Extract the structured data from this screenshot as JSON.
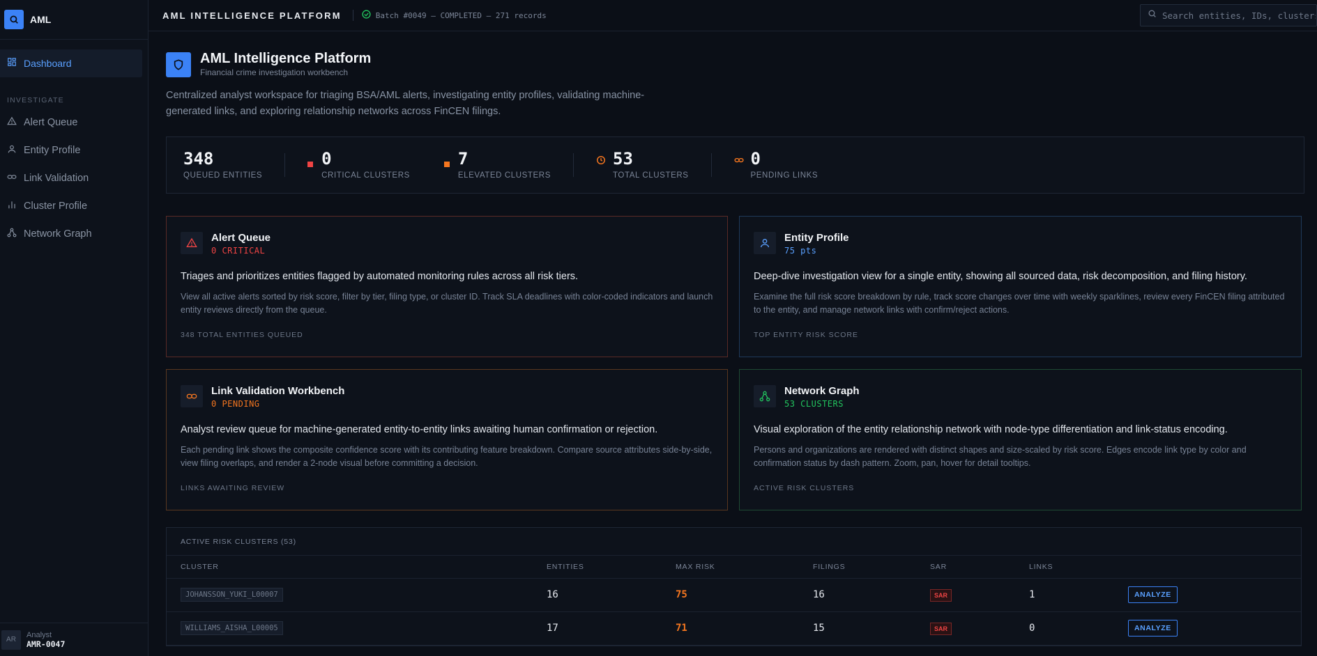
{
  "brand": {
    "name": "AML"
  },
  "sidebar": {
    "active": {
      "label": "Dashboard"
    },
    "section_label": "INVESTIGATE",
    "items": [
      {
        "label": "Alert Queue",
        "icon": "alert-triangle-icon"
      },
      {
        "label": "Entity Profile",
        "icon": "user-icon"
      },
      {
        "label": "Link Validation",
        "icon": "link-icon"
      },
      {
        "label": "Cluster Profile",
        "icon": "bar-chart-icon"
      },
      {
        "label": "Network Graph",
        "icon": "network-icon"
      }
    ],
    "user": {
      "initials": "AR",
      "role": "Analyst",
      "id": "AMR-0047"
    }
  },
  "topbar": {
    "title": "AML INTELLIGENCE PLATFORM",
    "batch": "Batch #0049 — COMPLETED — 271 records",
    "search_placeholder": "Search entities, IDs, clusters..."
  },
  "header": {
    "title": "AML Intelligence Platform",
    "subtitle": "Financial crime investigation workbench",
    "description": "Centralized analyst workspace for triaging BSA/AML alerts, investigating entity profiles, validating machine-generated links, and exploring relationship networks across FinCEN filings."
  },
  "stats": [
    {
      "value": "348",
      "label": "QUEUED ENTITIES"
    },
    {
      "value": "0",
      "label": "CRITICAL CLUSTERS"
    },
    {
      "value": "7",
      "label": "ELEVATED CLUSTERS"
    },
    {
      "value": "53",
      "label": "TOTAL CLUSTERS"
    },
    {
      "value": "0",
      "label": "PENDING LINKS"
    }
  ],
  "cards": {
    "alert": {
      "title": "Alert Queue",
      "meta": "0 CRITICAL",
      "lead": "Triages and prioritizes entities flagged by automated monitoring rules across all risk tiers.",
      "body": "View all active alerts sorted by risk score, filter by tier, filing type, or cluster ID. Track SLA deadlines with color-coded indicators and launch entity reviews directly from the queue.",
      "foot": "348 TOTAL ENTITIES QUEUED"
    },
    "entity": {
      "title": "Entity Profile",
      "meta": "75 pts",
      "lead": "Deep-dive investigation view for a single entity, showing all sourced data, risk decomposition, and filing history.",
      "body": "Examine the full risk score breakdown by rule, track score changes over time with weekly sparklines, review every FinCEN filing attributed to the entity, and manage network links with confirm/reject actions.",
      "foot": "TOP ENTITY RISK SCORE"
    },
    "link": {
      "title": "Link Validation Workbench",
      "meta": "0 PENDING",
      "lead": "Analyst review queue for machine-generated entity-to-entity links awaiting human confirmation or rejection.",
      "body": "Each pending link shows the composite confidence score with its contributing feature breakdown. Compare source attributes side-by-side, view filing overlaps, and render a 2-node visual before committing a decision.",
      "foot": "LINKS AWAITING REVIEW"
    },
    "network": {
      "title": "Network Graph",
      "meta": "53 CLUSTERS",
      "lead": "Visual exploration of the entity relationship network with node-type differentiation and link-status encoding.",
      "body": "Persons and organizations are rendered with distinct shapes and size-scaled by risk score. Edges encode link type by color and confirmation status by dash pattern. Zoom, pan, hover for detail tooltips.",
      "foot": "ACTIVE RISK CLUSTERS"
    }
  },
  "clusters_table": {
    "title": "ACTIVE RISK CLUSTERS (53)",
    "columns": [
      "CLUSTER",
      "ENTITIES",
      "MAX RISK",
      "FILINGS",
      "SAR",
      "LINKS",
      ""
    ],
    "rows": [
      {
        "cluster": "JOHANSSON_YUKI_L00007",
        "entities": "16",
        "max_risk": "75",
        "filings": "16",
        "sar": "SAR",
        "links": "1",
        "action": "ANALYZE"
      },
      {
        "cluster": "WILLIAMS_AISHA_L00005",
        "entities": "17",
        "max_risk": "71",
        "filings": "15",
        "sar": "SAR",
        "links": "0",
        "action": "ANALYZE"
      }
    ]
  },
  "colors": {
    "accent": "#3b82f6",
    "critical": "#ef4444",
    "elevated": "#f5761f",
    "success": "#22c55e"
  }
}
